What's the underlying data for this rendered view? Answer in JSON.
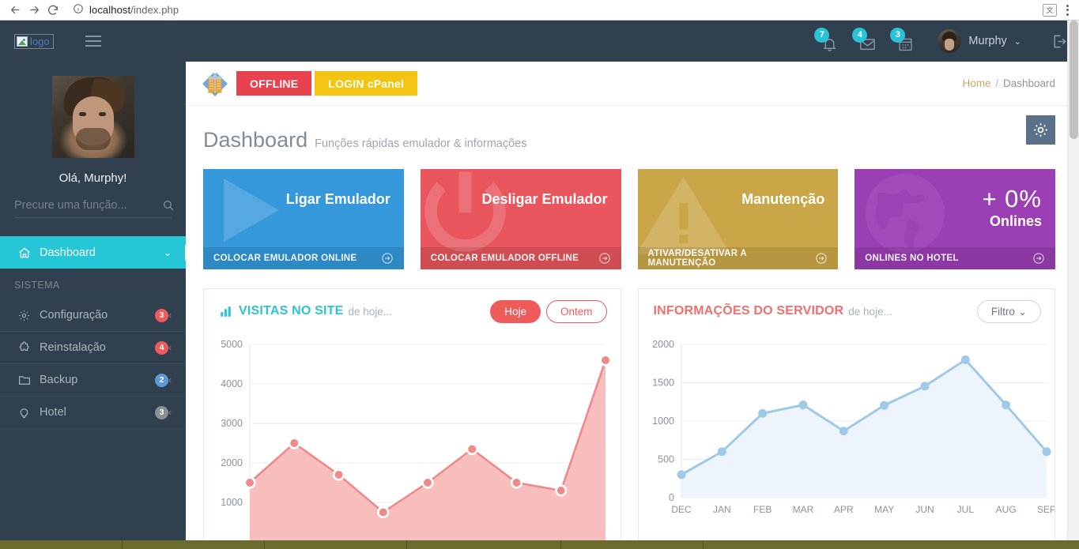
{
  "browser": {
    "back_icon": "arrow-left-icon",
    "forward_icon": "arrow-right-icon",
    "reload_icon": "reload-icon",
    "info_icon": "info-circle-icon",
    "url_host": "localhost",
    "url_path": "/index.php",
    "translate_icon": "translate-icon",
    "menu_icon": "kebab-menu-icon"
  },
  "topbar": {
    "logo_alt": "logo",
    "hamburger_icon": "hamburger-icon",
    "notifications": {
      "icon": "bell-icon",
      "badge": "7"
    },
    "messages": {
      "icon": "envelope-icon",
      "badge": "4"
    },
    "tasks": {
      "icon": "calendar-tasks-icon",
      "badge": "3"
    },
    "user_name": "Murphy",
    "chevron": "⌄",
    "logout_icon": "logout-icon",
    "badge_color": "#28c3d7",
    "bg_color": "#31404e"
  },
  "sidebar": {
    "greeting": "Olá, Murphy!",
    "avatar_name": "avatar",
    "search": {
      "placeholder": "Precure uma função...",
      "value": "",
      "icon": "search-icon"
    },
    "active": {
      "label": "Dashboard",
      "icon": "home-icon",
      "chevron": "⌄",
      "accent": "#25c6d6"
    },
    "section_label": "SISTEMA",
    "items": [
      {
        "label": "Configuração",
        "icon": "gear-icon",
        "badge": "3",
        "badge_color": "#ef5a5a",
        "chevron": "‹"
      },
      {
        "label": "Reinstalação",
        "icon": "puzzle-icon",
        "badge": "4",
        "badge_color": "#ef5a5a",
        "chevron": "‹"
      },
      {
        "label": "Backup",
        "icon": "folder-icon",
        "badge": "2",
        "badge_color": "#5b9bd5",
        "chevron": "‹"
      },
      {
        "label": "Hotel",
        "icon": "lightbulb-icon",
        "badge": "3",
        "badge_color": "#8a8f93",
        "chevron": "‹"
      }
    ]
  },
  "action_bar": {
    "hotel_icon": "habbo-hotel-icon",
    "offline_button": "OFFLINE",
    "offline_color": "#e8414f",
    "cpanel_button": "LOGIN cPanel",
    "cpanel_color": "#f3c512",
    "breadcrumb_home": "Home",
    "breadcrumb_sep": "/",
    "breadcrumb_current": "Dashboard"
  },
  "settings_fab": {
    "icon": "gear-icon"
  },
  "page": {
    "title": "Dashboard",
    "subtitle": "Funções rápidas emulador & informações"
  },
  "cards": [
    {
      "title": "Ligar Emulador",
      "footer": "COLOCAR EMULADOR ONLINE",
      "color": "#3498db",
      "watermark": "play-icon",
      "arrow": "arrow-circle-right-icon"
    },
    {
      "title": "Desligar Emulador",
      "footer": "COLOCAR EMULADOR OFFLINE",
      "color": "#e8555d",
      "watermark": "power-icon",
      "arrow": "arrow-circle-right-icon"
    },
    {
      "title": "Manutenção",
      "footer": "ATIVAR/DESATIVAR A MANUTENÇÃO",
      "color": "#cba649",
      "watermark": "warning-triangle-icon",
      "arrow": "arrow-circle-right-icon"
    },
    {
      "title": "",
      "big_value": "+ 0%",
      "big_label": "Onlines",
      "footer": "ONLINES NO HOTEL",
      "color": "#9b3fb5",
      "watermark": "globe-icon",
      "arrow": "arrow-circle-right-icon"
    }
  ],
  "panels": {
    "visits": {
      "icon": "bar-chart-icon",
      "title": "VISITAS NO SITE",
      "subtitle": "de hoje...",
      "btn_today": "Hoje",
      "btn_yesterday": "Ontem",
      "accent": "#2ec2d4"
    },
    "server": {
      "title": "INFORMAÇÕES DO SERVIDOR",
      "subtitle": "de hoje...",
      "filter_label": "Filtro",
      "filter_chevron": "⌄",
      "accent": "#ef6e6e"
    }
  },
  "chart_data": [
    {
      "type": "area",
      "name": "visitas-no-site",
      "title": "VISITAS NO SITE",
      "xlabel": "",
      "ylabel": "",
      "x": [
        "1",
        "2",
        "3",
        "4",
        "5",
        "6",
        "7",
        "8",
        "9"
      ],
      "values": [
        1500,
        2500,
        1700,
        750,
        1500,
        2350,
        1500,
        1300,
        4600
      ],
      "ylim": [
        0,
        5000
      ],
      "yticks": [
        1000,
        2000,
        3000,
        4000,
        5000
      ],
      "grid": true,
      "line_color": "#ef8a8a",
      "fill_color": "#f8bdbd",
      "point_color": "#ef8a8a",
      "legend": "none"
    },
    {
      "type": "area",
      "name": "informacoes-do-servidor",
      "title": "INFORMAÇÕES DO SERVIDOR",
      "xlabel": "",
      "ylabel": "",
      "categories": [
        "DEC",
        "JAN",
        "FEB",
        "MAR",
        "APR",
        "MAY",
        "JUN",
        "JUL",
        "AUG",
        "SEP"
      ],
      "values": [
        300,
        600,
        1100,
        1210,
        870,
        1205,
        1455,
        1800,
        1210,
        600
      ],
      "ylim": [
        0,
        2000
      ],
      "yticks": [
        0,
        500,
        1000,
        1500,
        2000
      ],
      "grid": true,
      "line_color": "#9ecae8",
      "fill_color": "#eef4fb",
      "point_color": "#9ecae8",
      "legend": "none"
    }
  ],
  "mini_stats": {
    "bar_colors": [
      "#2ec2c2",
      "#5b92d6",
      "#ef5a6e",
      "#f0c419"
    ]
  },
  "scrollbar": {
    "name": "vertical-scrollbar"
  }
}
